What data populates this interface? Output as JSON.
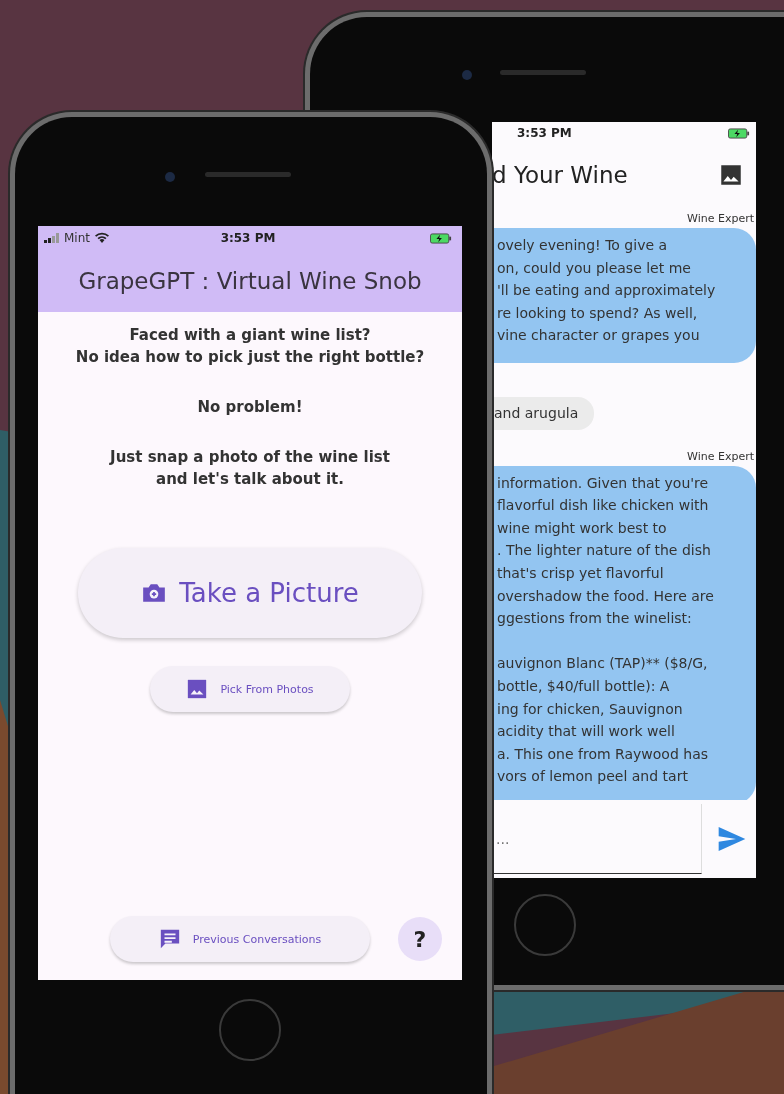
{
  "back_phone": {
    "status_bar": {
      "time": "3:53 PM"
    },
    "app_bar": {
      "title": "d Your Wine"
    },
    "messages": [
      {
        "kind": "bot",
        "sender": "Wine Expert",
        "lines": [
          "ovely evening! To give a",
          "on, could you please let me",
          "'ll be eating and approximately",
          "re looking to spend? As well,",
          "vine character or grapes you"
        ]
      },
      {
        "kind": "user",
        "lines": [
          "and arugula"
        ]
      },
      {
        "kind": "bot",
        "sender": "Wine Expert",
        "paragraphs": [
          [
            "information. Given that you're",
            "flavorful dish like chicken with",
            "wine might work best to",
            ". The lighter nature of the dish",
            "that's crisp yet flavorful",
            "overshadow the food. Here are",
            "ggestions from the winelist:"
          ],
          [
            "auvignon Blanc (TAP)** ($8/G,",
            "bottle, $40/full bottle): A",
            "ing for chicken, Sauvignon",
            "acidity that will work well",
            "a. This one from Raywood has",
            "vors of lemon peel and tart"
          ]
        ]
      }
    ],
    "input": {
      "placeholder": "..."
    }
  },
  "front_phone": {
    "status_bar": {
      "carrier": "Mint",
      "time": "3:53 PM"
    },
    "app_bar": {
      "title": "GrapeGPT : Virtual Wine Snob"
    },
    "intro": [
      "Faced with a giant wine list?\nNo idea how to pick just the right bottle?",
      "No problem!",
      "Just snap a photo of the wine list\nand let's talk about it."
    ],
    "take_picture": {
      "label": "Take a Picture"
    },
    "pick_photos": {
      "label": "Pick From Photos"
    },
    "previous_conversations": {
      "label": "Previous Conversations"
    },
    "help": {
      "label": "?"
    }
  }
}
